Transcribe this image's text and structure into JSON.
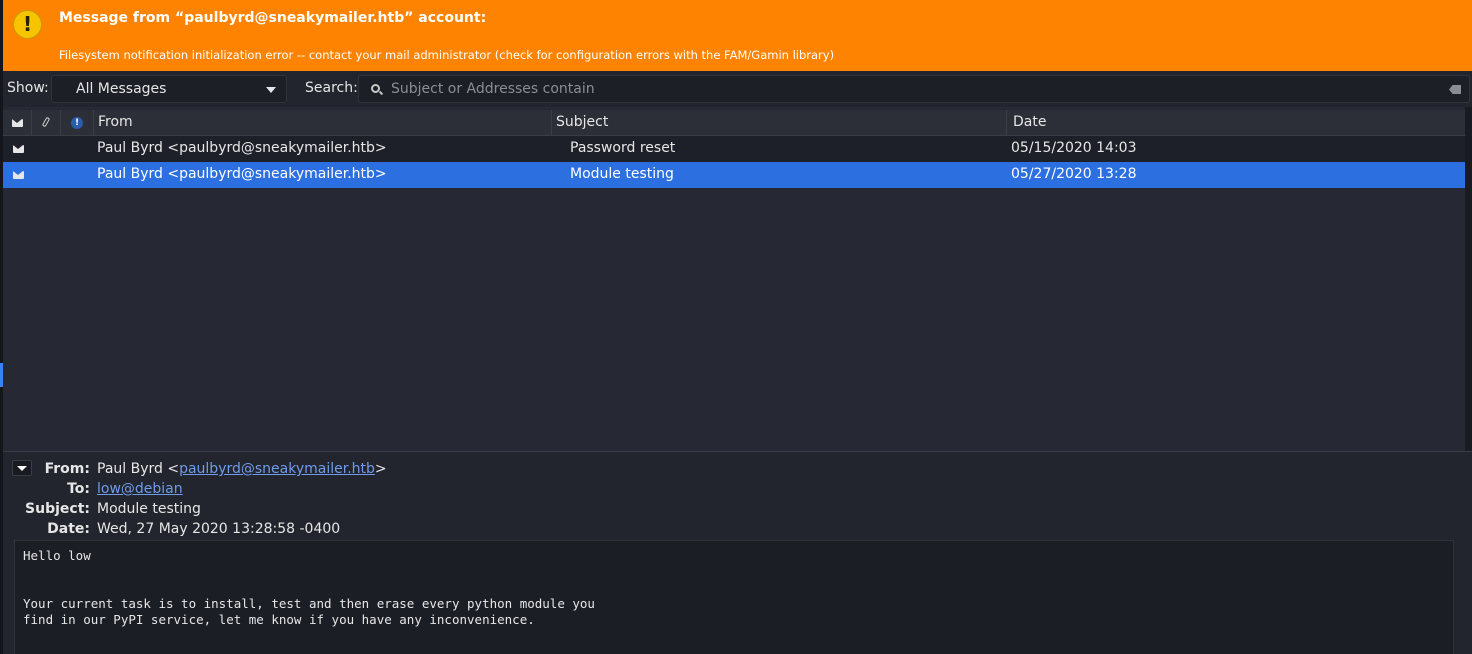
{
  "alert": {
    "icon": "warning-icon",
    "title": "Message from “paulbyrd@sneakymailer.htb” account:",
    "body": "Filesystem notification initialization error -- contact your mail administrator (check for configuration errors with the FAM/Gamin library)",
    "color": "#fe8300"
  },
  "filter": {
    "show_label": "Show:",
    "show_value": "All Messages",
    "search_label": "Search:",
    "search_placeholder": "Subject or Addresses contain"
  },
  "list": {
    "columns": {
      "from": "From",
      "subject": "Subject",
      "date": "Date"
    },
    "rows": [
      {
        "from": "Paul Byrd <paulbyrd@sneakymailer.htb>",
        "subject": "Password reset",
        "date": "05/15/2020 14:03",
        "selected": false
      },
      {
        "from": "Paul Byrd <paulbyrd@sneakymailer.htb>",
        "subject": "Module testing",
        "date": "05/27/2020 13:28",
        "selected": true
      }
    ],
    "selection_color": "#2c6fe0"
  },
  "preview": {
    "labels": {
      "from": "From:",
      "to": "To:",
      "subject": "Subject:",
      "date": "Date:"
    },
    "from_name": "Paul Byrd <",
    "from_email": "paulbyrd@sneakymailer.htb",
    "from_suffix": ">",
    "to": "low@debian",
    "subject": "Module testing",
    "date": "Wed, 27 May 2020 13:28:58 -0400",
    "body": "Hello low\n\n\nYour current task is to install, test and then erase every python module you\nfind in our PyPI service, let me know if you have any inconvenience."
  }
}
